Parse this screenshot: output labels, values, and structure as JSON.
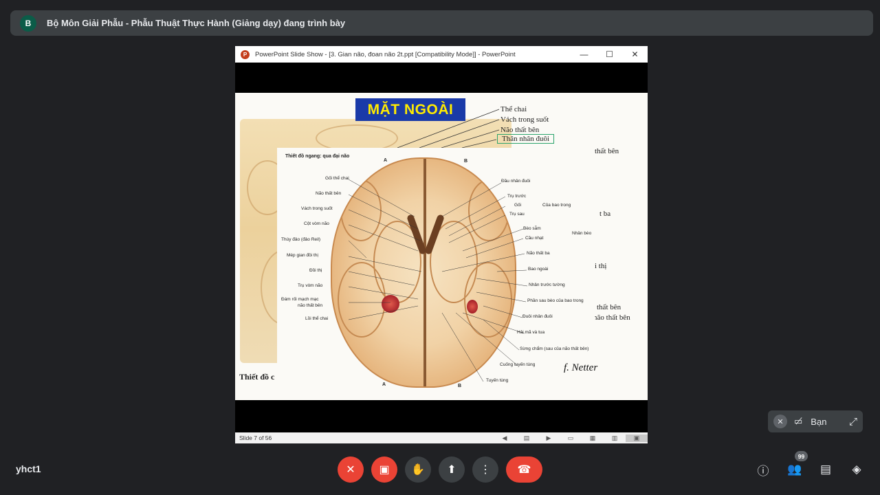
{
  "banner": {
    "avatar_letter": "B",
    "text": "Bộ Môn Giải Phẫu - Phẫu Thuật Thực Hành (Giảng dạy) đang trình bày"
  },
  "ppt": {
    "logo_letter": "P",
    "title": "PowerPoint Slide Show - [3. Gian não, đoan não 2t.ppt [Compatibility Mode]] - PowerPoint",
    "minimize": "—",
    "maximize": "☐",
    "close": "✕",
    "status": "Slide 7 of 56"
  },
  "slide": {
    "heading": "MẶT NGOÀI",
    "top_labels": [
      "Thể chai",
      "Vách trong suốt",
      "Não thất bên",
      "Thân nhân đuôi"
    ],
    "right_labels": [
      "thất bên",
      "t ba",
      "i thị",
      "thất bên",
      "não thất bên"
    ],
    "bg_caption": "Thiết đồ c",
    "signature": "f. Netter"
  },
  "figure": {
    "caption": "Thiết đồ ngang: qua đại não",
    "letters": [
      "A",
      "B",
      "A",
      "B"
    ],
    "left_labels": [
      "Gối thể chai",
      "Não thất bên",
      "Vách trong suốt",
      "Cột vòm não",
      "Thùy đảo (đảo Reil)",
      "Mép gian đồi thị",
      "Đồi thị",
      "Trụ vòm não",
      "Đám rối mạch mạc",
      "não thất bên",
      "Lồi thể chai"
    ],
    "right_labels": [
      "Đầu nhân đuôi",
      "Trụ trước",
      "Gối",
      "Trụ sau",
      "Của bao trong",
      "Bèo sẫm",
      "Cầu nhạt",
      "Nhân bèo",
      "Não thất ba",
      "Bao ngoài",
      "Nhân trước tường",
      "Phần sau bèo của bao trong",
      "Đuôi nhân đuôi",
      "Hải mã và tua",
      "Sừng chẩm (sau của não thất bên)",
      "Cuống tuyến tùng",
      "Tuyến tùng"
    ]
  },
  "self_view": {
    "name": "Bạn"
  },
  "bottom": {
    "meeting_code": "yhct1",
    "participants_count": "99"
  }
}
